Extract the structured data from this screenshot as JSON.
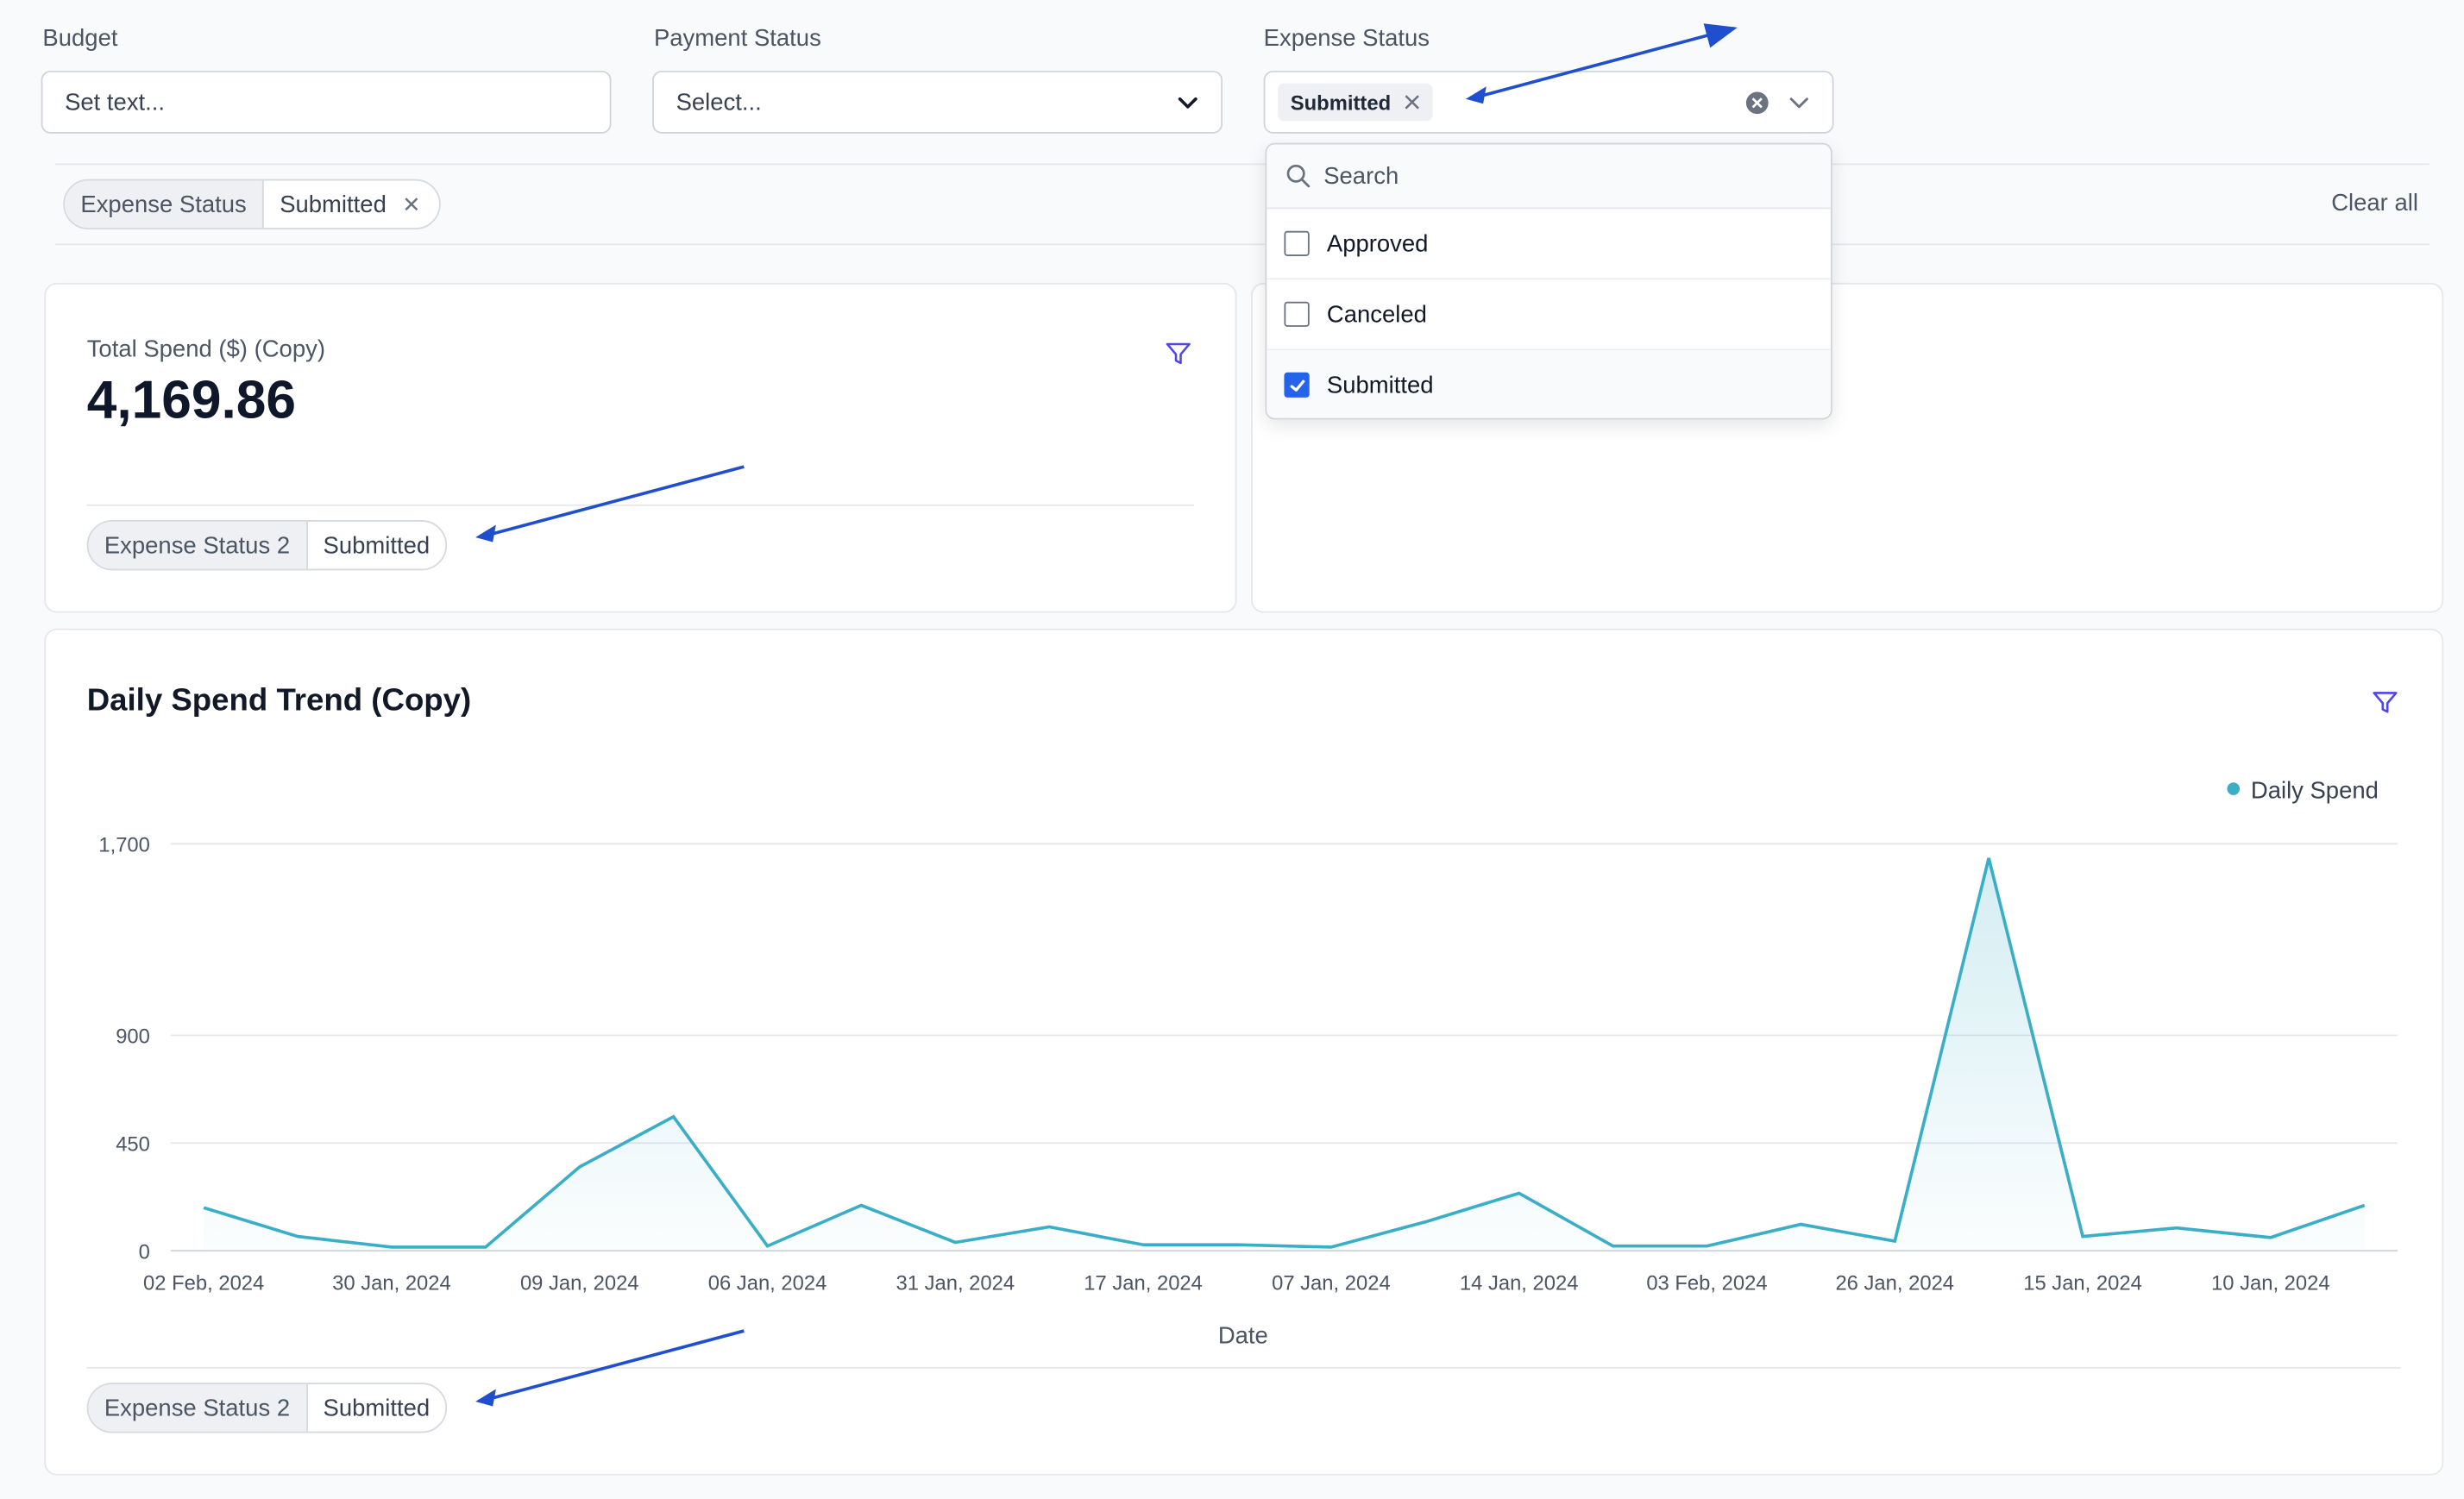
{
  "filters": {
    "budget": {
      "label": "Budget",
      "placeholder": "Set text..."
    },
    "payment_status": {
      "label": "Payment Status",
      "placeholder": "Select..."
    },
    "expense_status": {
      "label": "Expense Status",
      "selected_chip": "Submitted",
      "search_placeholder": "Search",
      "options": [
        {
          "label": "Approved",
          "checked": false
        },
        {
          "label": "Canceled",
          "checked": false
        },
        {
          "label": "Submitted",
          "checked": true
        }
      ]
    }
  },
  "active_filters": {
    "pill_key": "Expense Status",
    "pill_value": "Submitted",
    "clear_all": "Clear all"
  },
  "kpi_card": {
    "title": "Total Spend ($) (Copy)",
    "value": "4,169.86",
    "filter_key": "Expense Status 2",
    "filter_value": "Submitted"
  },
  "trend_card": {
    "title": "Daily Spend Trend (Copy)",
    "filter_key": "Expense Status 2",
    "filter_value": "Submitted"
  },
  "colors": {
    "accent": "#2563eb",
    "line": "#3aaec7",
    "annotation_arrow": "#1f4fcf"
  },
  "chart_data": {
    "type": "area",
    "title": "",
    "xlabel": "Date",
    "ylabel": "",
    "yticks": [
      "0",
      "450",
      "900",
      "1,700"
    ],
    "ytick_values": [
      0,
      450,
      900,
      1700
    ],
    "ylim": [
      0,
      1700
    ],
    "grid": true,
    "legend": "top-right",
    "x_tick_labels": [
      "02 Feb, 2024",
      "30 Jan, 2024",
      "09 Jan, 2024",
      "06 Jan, 2024",
      "31 Jan, 2024",
      "17 Jan, 2024",
      "07 Jan, 2024",
      "14 Jan, 2024",
      "03 Feb, 2024",
      "26 Jan, 2024",
      "15 Jan, 2024",
      "10 Jan, 2024"
    ],
    "series": [
      {
        "name": "Daily Spend",
        "values": [
          180,
          60,
          15,
          15,
          350,
          560,
          20,
          190,
          35,
          100,
          25,
          25,
          15,
          120,
          240,
          20,
          20,
          110,
          40,
          1640,
          60,
          95,
          55,
          190
        ]
      }
    ]
  }
}
